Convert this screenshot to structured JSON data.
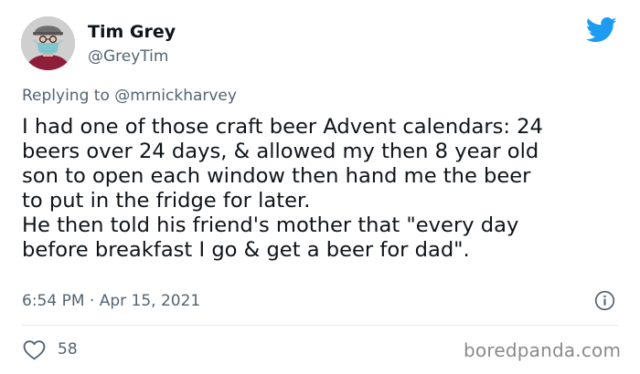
{
  "author": {
    "display_name": "Tim Grey",
    "handle": "@GreyTim",
    "avatar_icon": "avatar-man-with-mask"
  },
  "reply": {
    "prefix": "Replying to",
    "target": "@mrnickharvey"
  },
  "tweet": {
    "lines": [
      "I had one of those craft beer Advent calendars: 24",
      "beers over 24 days, & allowed my then 8 year old",
      "son to open each window then hand me the beer",
      "to put in the fridge for later.",
      "He then told his friend's mother that \"every day",
      "before breakfast I go & get a beer for dad\"."
    ],
    "timestamp": "6:54 PM · Apr 15, 2021"
  },
  "actions": {
    "like_icon": "heart-outline-icon",
    "like_count": "58",
    "info_icon": "info-icon"
  },
  "brand": {
    "platform_icon": "twitter-bird-icon",
    "twitter_blue": "#1d9bf0",
    "watermark": "boredpanda.com"
  }
}
